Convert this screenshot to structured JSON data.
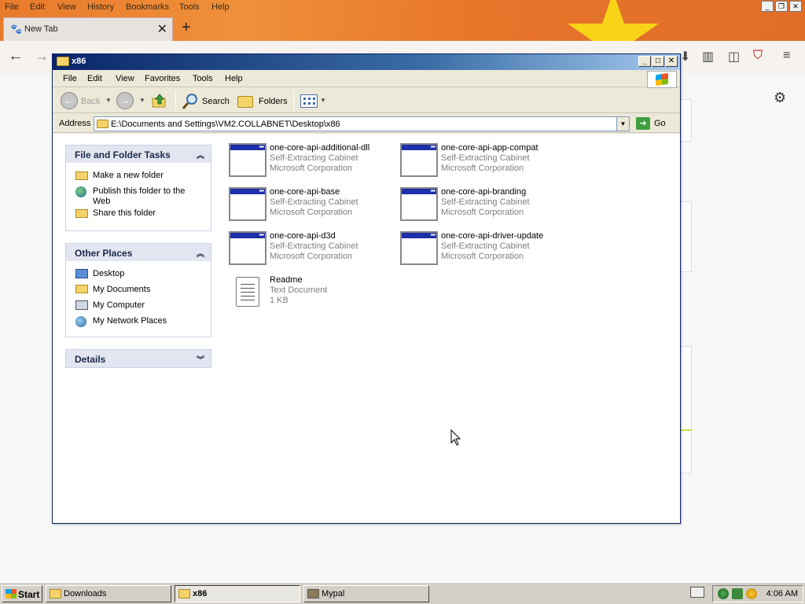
{
  "firefox": {
    "menu": [
      "File",
      "Edit",
      "View",
      "History",
      "Bookmarks",
      "Tools",
      "Help"
    ],
    "tab_label": "New Tab"
  },
  "explorer": {
    "title": "x86",
    "menu": [
      "File",
      "Edit",
      "View",
      "Favorites",
      "Tools",
      "Help"
    ],
    "toolbar": {
      "back_label": "Back",
      "search_label": "Search",
      "folders_label": "Folders"
    },
    "address": {
      "label": "Address",
      "value": "E:\\Documents and Settings\\VM2.COLLABNET\\Desktop\\x86",
      "go_label": "Go"
    },
    "tasks": {
      "file_folder": {
        "title": "File and Folder Tasks",
        "items": [
          "Make a new folder",
          "Publish this folder to the Web",
          "Share this folder"
        ]
      },
      "other_places": {
        "title": "Other Places",
        "items": [
          "Desktop",
          "My Documents",
          "My Computer",
          "My Network Places"
        ]
      },
      "details": {
        "title": "Details"
      }
    },
    "files": [
      {
        "name": "one-core-api-additional-dll",
        "type": "Self-Extracting Cabinet",
        "detail": "Microsoft Corporation",
        "icon": "cabinet-icon"
      },
      {
        "name": "one-core-api-app-compat",
        "type": "Self-Extracting Cabinet",
        "detail": "Microsoft Corporation",
        "icon": "cabinet-icon"
      },
      {
        "name": "one-core-api-base",
        "type": "Self-Extracting Cabinet",
        "detail": "Microsoft Corporation",
        "icon": "cabinet-icon"
      },
      {
        "name": "one-core-api-branding",
        "type": "Self-Extracting Cabinet",
        "detail": "Microsoft Corporation",
        "icon": "cabinet-icon"
      },
      {
        "name": "one-core-api-d3d",
        "type": "Self-Extracting Cabinet",
        "detail": "Microsoft Corporation",
        "icon": "cabinet-icon"
      },
      {
        "name": "one-core-api-driver-update",
        "type": "Self-Extracting Cabinet",
        "detail": "Microsoft Corporation",
        "icon": "cabinet-icon"
      },
      {
        "name": "Readme",
        "type": "Text Document",
        "detail": "1 KB",
        "icon": "text-document-icon"
      }
    ]
  },
  "taskbar": {
    "start_label": "Start",
    "buttons": [
      "Downloads",
      "x86",
      "Mypal"
    ],
    "clock": "4:06 AM"
  },
  "colors": {
    "titlebar": "#0a246a",
    "firefox_theme": "#e87a2c",
    "flag_star": "#f7d417"
  }
}
